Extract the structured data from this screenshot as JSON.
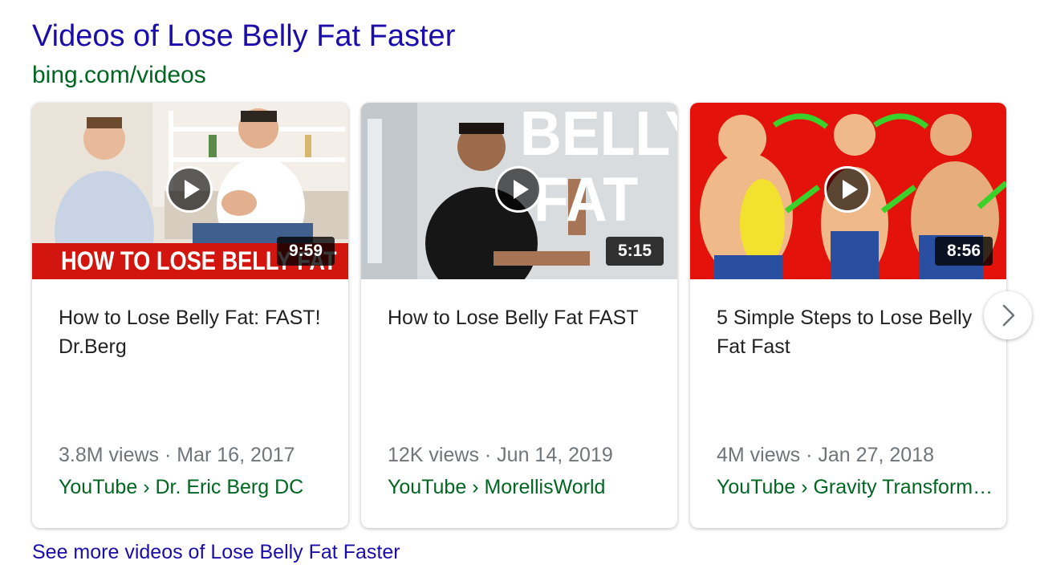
{
  "header": {
    "title": "Videos of Lose Belly Fat Faster",
    "site": "bing.com/videos"
  },
  "videos": [
    {
      "title": "How to Lose Belly Fat: FAST! Dr.Berg",
      "duration": "9:59",
      "thumb_caption": "HOW TO LOSE BELLY FAT",
      "views": "3.8M views",
      "date": "Mar 16, 2017",
      "source": "YouTube › Dr. Eric Berg DC"
    },
    {
      "title": "How to Lose Belly Fat FAST",
      "duration": "5:15",
      "thumb_text_1": "BELLY",
      "thumb_text_2": "FAT",
      "views": "12K views",
      "date": "Jun 14, 2019",
      "source": "YouTube › MorellisWorld"
    },
    {
      "title": "5 Simple Steps to Lose Belly Fat Fast",
      "duration": "8:56",
      "views": "4M views",
      "date": "Jan 27, 2018",
      "source": "YouTube › Gravity Transformation"
    }
  ],
  "meta_separator": " · ",
  "next_icon": "chevron-right-icon",
  "more_link": "See more videos of Lose Belly Fat Faster",
  "colors": {
    "title_link": "#1a0dab",
    "site_green": "#006621",
    "meta_gray": "#70757a",
    "thumb_red": "#e3120b"
  }
}
